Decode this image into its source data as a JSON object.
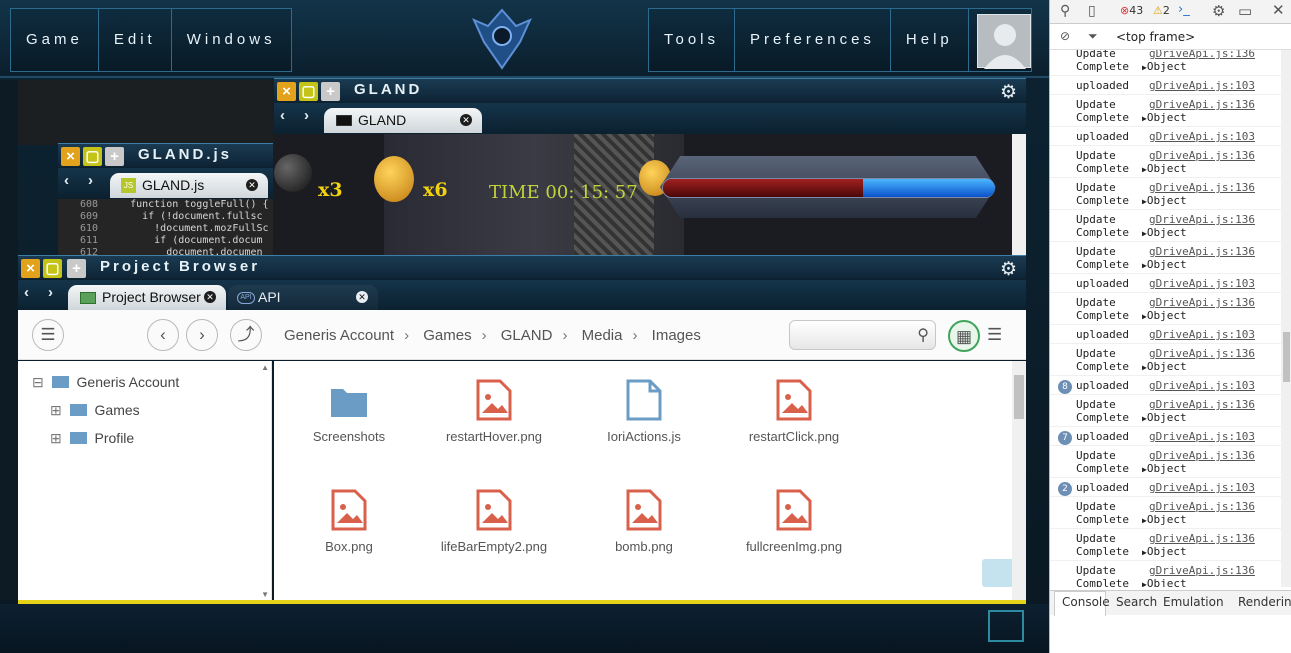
{
  "menus": {
    "left": [
      "Game",
      "Edit",
      "Windows"
    ],
    "right": [
      "Tools",
      "Preferences",
      "Help"
    ]
  },
  "gland_panel": {
    "title": "GLAND",
    "tab": "GLAND",
    "hud": {
      "bombs": "x3",
      "coins": "x6",
      "time_label": "TIME",
      "time": "00: 15: 57"
    }
  },
  "code_panel": {
    "title": "GLAND.js",
    "tab": "GLAND.js",
    "lines": [
      {
        "num": "608",
        "text": "    function toggleFull() {"
      },
      {
        "num": "609",
        "text": "      if (!document.fullsc"
      },
      {
        "num": "610",
        "text": "        !document.mozFullSc"
      },
      {
        "num": "611",
        "text": "        if (document.docum"
      },
      {
        "num": "612",
        "text": "          document.documen"
      }
    ]
  },
  "project_browser": {
    "title": "Project Browser",
    "tabs": [
      "Project Browser",
      "API"
    ],
    "breadcrumb": [
      "Generis Account",
      "Games",
      "GLAND",
      "Media",
      "Images"
    ],
    "search_placeholder": "",
    "tree": [
      {
        "label": "Generis Account",
        "toggle": "⊟"
      },
      {
        "label": "Games",
        "toggle": "⊞"
      },
      {
        "label": "Profile",
        "toggle": "⊞"
      }
    ],
    "files": [
      {
        "name": "Screenshots",
        "kind": "folder"
      },
      {
        "name": "restartHover.png",
        "kind": "image"
      },
      {
        "name": "IoriActions.js",
        "kind": "file"
      },
      {
        "name": "restartClick.png",
        "kind": "image"
      },
      {
        "name": "Box.png",
        "kind": "image"
      },
      {
        "name": "lifeBarEmpty2.png",
        "kind": "image"
      },
      {
        "name": "bomb.png",
        "kind": "image"
      },
      {
        "name": "fullcreenImg.png",
        "kind": "image"
      }
    ]
  },
  "devtools": {
    "errors": "43",
    "warnings": "2",
    "frame": "<top frame>",
    "tabs": [
      "Console",
      "Search",
      "Emulation",
      "Rendering"
    ],
    "rows": [
      {
        "msg": "Update",
        "msg2": "Complete",
        "link": "gDriveApi.js:136",
        "obj": "Object",
        "badge": ""
      },
      {
        "msg": "uploaded",
        "msg2": "",
        "link": "gDriveApi.js:103",
        "obj": "",
        "badge": ""
      },
      {
        "msg": "Update",
        "msg2": "Complete",
        "link": "gDriveApi.js:136",
        "obj": "Object",
        "badge": ""
      },
      {
        "msg": "uploaded",
        "msg2": "",
        "link": "gDriveApi.js:103",
        "obj": "",
        "badge": ""
      },
      {
        "msg": "Update",
        "msg2": "Complete",
        "link": "gDriveApi.js:136",
        "obj": "Object",
        "badge": ""
      },
      {
        "msg": "Update",
        "msg2": "Complete",
        "link": "gDriveApi.js:136",
        "obj": "Object",
        "badge": ""
      },
      {
        "msg": "Update",
        "msg2": "Complete",
        "link": "gDriveApi.js:136",
        "obj": "Object",
        "badge": ""
      },
      {
        "msg": "Update",
        "msg2": "Complete",
        "link": "gDriveApi.js:136",
        "obj": "Object",
        "badge": ""
      },
      {
        "msg": "uploaded",
        "msg2": "",
        "link": "gDriveApi.js:103",
        "obj": "",
        "badge": ""
      },
      {
        "msg": "Update",
        "msg2": "Complete",
        "link": "gDriveApi.js:136",
        "obj": "Object",
        "badge": ""
      },
      {
        "msg": "uploaded",
        "msg2": "",
        "link": "gDriveApi.js:103",
        "obj": "",
        "badge": ""
      },
      {
        "msg": "Update",
        "msg2": "Complete",
        "link": "gDriveApi.js:136",
        "obj": "Object",
        "badge": ""
      },
      {
        "msg": "uploaded",
        "msg2": "",
        "link": "gDriveApi.js:103",
        "obj": "",
        "badge": "8"
      },
      {
        "msg": "Update",
        "msg2": "Complete",
        "link": "gDriveApi.js:136",
        "obj": "Object",
        "badge": ""
      },
      {
        "msg": "uploaded",
        "msg2": "",
        "link": "gDriveApi.js:103",
        "obj": "",
        "badge": "7"
      },
      {
        "msg": "Update",
        "msg2": "Complete",
        "link": "gDriveApi.js:136",
        "obj": "Object",
        "badge": ""
      },
      {
        "msg": "uploaded",
        "msg2": "",
        "link": "gDriveApi.js:103",
        "obj": "",
        "badge": "2"
      },
      {
        "msg": "Update",
        "msg2": "Complete",
        "link": "gDriveApi.js:136",
        "obj": "Object",
        "badge": ""
      },
      {
        "msg": "Update",
        "msg2": "Complete",
        "link": "gDriveApi.js:136",
        "obj": "Object",
        "badge": ""
      },
      {
        "msg": "Update",
        "msg2": "Complete",
        "link": "gDriveApi.js:136",
        "obj": "Object",
        "badge": ""
      }
    ]
  },
  "colors": {
    "accent": "#2c6a8e",
    "window_close": "#e2a21c",
    "image_icon": "#d9614c",
    "folder_icon": "#6b9cc6"
  }
}
